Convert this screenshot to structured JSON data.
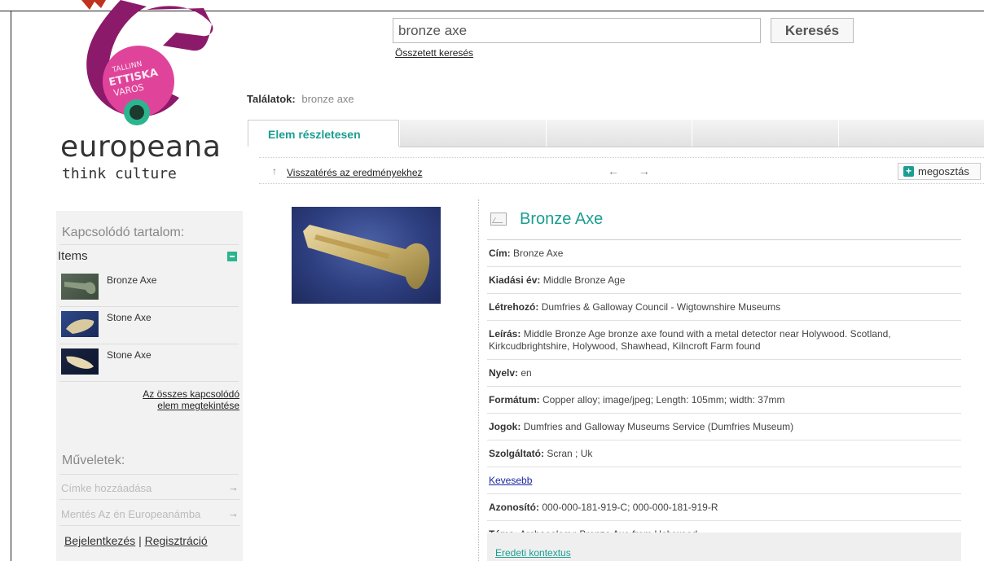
{
  "search": {
    "value": "bronze axe",
    "button_label": "Keresés",
    "advanced_link": "Összetett keresés"
  },
  "brand": {
    "name": "europeana",
    "tagline": "think culture",
    "badge_lines": [
      "TALLINN",
      "ETTISKA",
      "VAROS"
    ],
    "colors": {
      "accent": "#1a9e92",
      "logo_magenta": "#8c1a6a",
      "logo_pink": "#e0449a",
      "logo_green": "#2bb58f"
    }
  },
  "results": {
    "label": "Találatok:",
    "query": "bronze axe"
  },
  "tabs": [
    {
      "label": "Elem részletesen",
      "active": true
    },
    {
      "label": ""
    },
    {
      "label": ""
    },
    {
      "label": ""
    },
    {
      "label": ""
    }
  ],
  "toolbar": {
    "back_icon": "↑",
    "back_link": "Visszatérés az eredményekhez",
    "prev_icon": "←",
    "next_icon": "→",
    "share_icon": "+",
    "share_label": "megosztás"
  },
  "detail": {
    "title": "Bronze Axe",
    "title_icon": "image-icon",
    "rows": [
      {
        "label": "Cím:",
        "value": "Bronze Axe"
      },
      {
        "label": "Kiadási év:",
        "value": "Middle Bronze Age"
      },
      {
        "label": "Létrehozó:",
        "value": "Dumfries & Galloway Council - Wigtownshire Museums"
      },
      {
        "label": "Leírás:",
        "value": "Middle Bronze Age bronze axe found with a metal detector near Holywood. Scotland, Kirkcudbrightshire, Holywood, Shawhead, Kilncroft Farm found"
      },
      {
        "label": "Nyelv:",
        "value": "en"
      },
      {
        "label": "Formátum:",
        "value": "Copper alloy;  image/jpeg;  Length: 105mm; width: 37mm"
      },
      {
        "label": "Jogok:",
        "value": "Dumfries and Galloway Museums Service (Dumfries Museum)"
      },
      {
        "label": "Szolgáltató:",
        "value": "Scran ;  Uk"
      }
    ],
    "less_link": "Kevesebb",
    "rows_after": [
      {
        "label": "Azonosító:",
        "value": "000-000-181-919-C;  000-000-181-919-R"
      },
      {
        "label": "Téma:",
        "value": "Archaeology;  Bronze Axe from Holywood"
      }
    ],
    "context_link": "Eredeti kontextus"
  },
  "sidebar": {
    "related_heading": "Kapcsolódó tartalom:",
    "items_label": "Items",
    "items": [
      {
        "label": "Bronze Axe"
      },
      {
        "label": "Stone Axe"
      },
      {
        "label": "Stone Axe"
      }
    ],
    "view_all_line1": "Az összes kapcsolódó",
    "view_all_line2": "elem megtekintése",
    "actions_heading": "Műveletek:",
    "actions": [
      {
        "label": "Címke hozzáadása",
        "icon": "→"
      },
      {
        "label": "Mentés Az én Europeanámba",
        "icon": "→"
      }
    ],
    "login": "Bejelentkezés",
    "separator": "|",
    "register": "Regisztráció"
  }
}
